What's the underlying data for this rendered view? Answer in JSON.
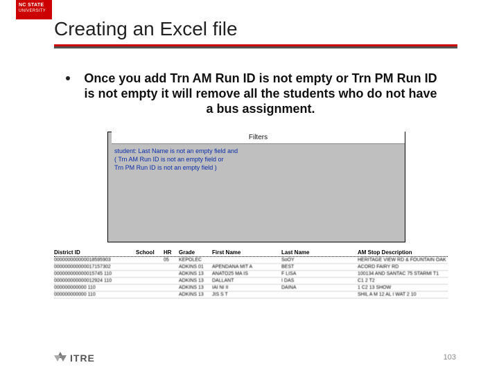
{
  "brand": {
    "line1": "NC STATE",
    "line2": "UNIVERSITY"
  },
  "title": "Creating an Excel file",
  "bullet": "Once you add Trn AM Run ID is not empty or Trn PM Run ID is not empty it will remove all the students who do not have a bus assignment.",
  "filters": {
    "tab_label": "Filters",
    "lines": [
      "student: Last Name  is not an empty field   and",
      "(  Trn AM Run ID  is not an empty field   or",
      "Trn PM Run ID  is not an empty field  )"
    ]
  },
  "table": {
    "headers": [
      "District ID",
      "School",
      "HR",
      "Grade",
      "First Name",
      "Last Name",
      "AM Stop Description"
    ],
    "rows": [
      [
        "000000000000018595903",
        "",
        "05",
        "KEPOLEC",
        "",
        "SoOY",
        "HERITAGE VIEW RD & FOUNTAIN OAK LN"
      ],
      [
        "000000000000017157302",
        "",
        "",
        "ADKINS 01",
        "APENDANA MIT A",
        "BEST",
        "ACORD   FAIRY RD"
      ],
      [
        "000000000000015745 110",
        "",
        "",
        "ADKINS 13",
        "ANATO25 MA  IS",
        "F LISA",
        "100134   AND SANTAC 75 STARMI T1"
      ],
      [
        "000000000000012924 110",
        "",
        "",
        "ADKINS 13",
        "DALLANT",
        "I DAS",
        "C1 2 T2"
      ],
      [
        "000000000000         110",
        "",
        "",
        "ADKINS 13",
        "IAI NI II",
        "DAINA",
        "1 C2 13  SHOW"
      ],
      [
        "000000000000         110",
        "",
        "",
        "ADKINS 13",
        "JIS S T",
        "",
        "SHIL  A  M 12 AL I  WAT  2  10"
      ]
    ]
  },
  "footer": {
    "itre": "ITRE",
    "page": "103"
  }
}
